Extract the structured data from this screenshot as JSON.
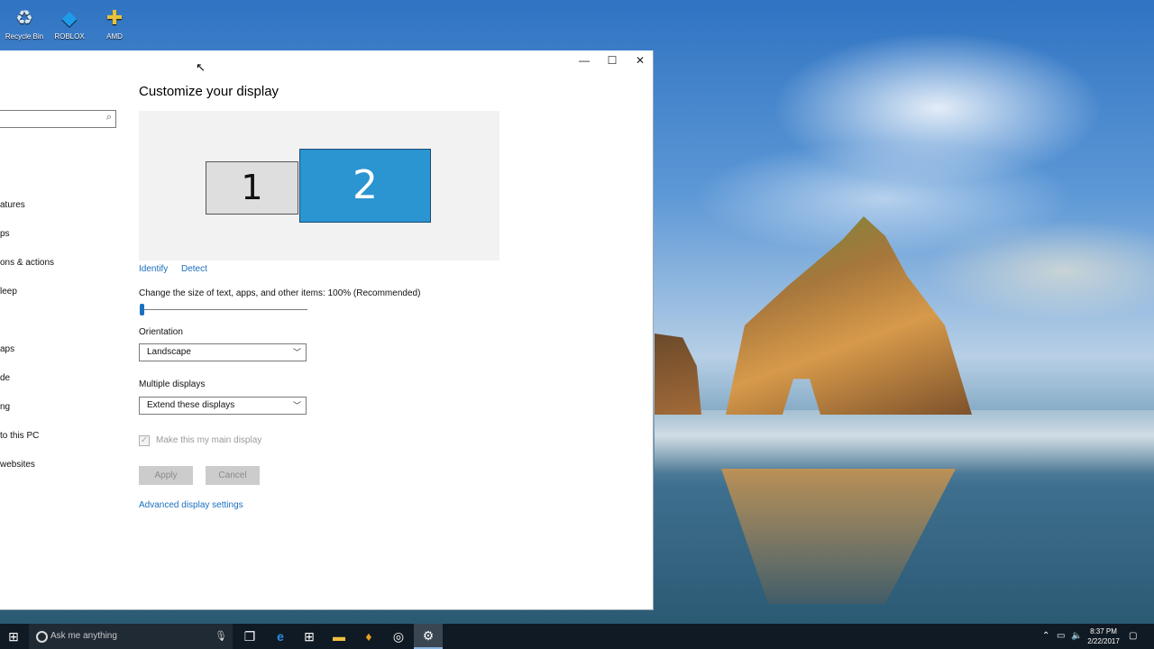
{
  "desktop": {
    "icons": [
      {
        "label": "Recycle Bin",
        "icon": "recycle-bin-icon",
        "glyph": "♻"
      },
      {
        "label": "ROBLOX",
        "icon": "roblox-studio-icon",
        "glyph": "◆"
      },
      {
        "label": "AMD",
        "icon": "amd-settings-icon",
        "glyph": "✚"
      }
    ]
  },
  "window": {
    "controls": {
      "minimize": "—",
      "maximize": "☐",
      "close": "✕"
    },
    "nav": {
      "search_placeholder": "",
      "items": [
        "atures",
        "ps",
        "ons & actions",
        "leep",
        "",
        "aps",
        "de",
        "ng",
        " to this PC",
        "websites"
      ]
    },
    "title": "Customize your display",
    "monitors": [
      "1",
      "2"
    ],
    "identify_link": "Identify",
    "detect_link": "Detect",
    "scale_label": "Change the size of text, apps, and other items: 100% (Recommended)",
    "scale_value_fraction": 0,
    "orientation": {
      "label": "Orientation",
      "value": "Landscape"
    },
    "multiple_displays": {
      "label": "Multiple displays",
      "value": "Extend these displays"
    },
    "main_display_checkbox": {
      "label": "Make this my main display",
      "checked": true,
      "enabled": false
    },
    "apply_button": "Apply",
    "cancel_button": "Cancel",
    "advanced_link": "Advanced display settings"
  },
  "taskbar": {
    "search_placeholder": "Ask me anything",
    "clock_time": "8:37 PM",
    "clock_date": "2/22/2017"
  },
  "colors": {
    "accent": "#1a6fbf",
    "selected_monitor": "#2a95d1",
    "taskbar": "#101a24"
  }
}
